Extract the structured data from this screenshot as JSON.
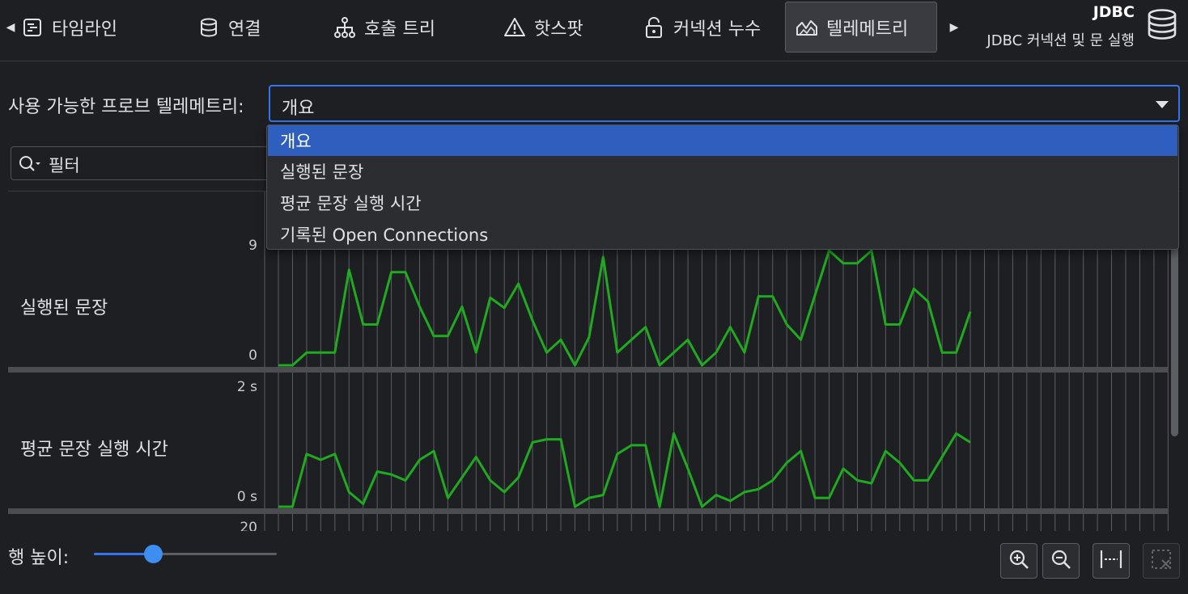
{
  "tabs": [
    {
      "label": "타임라인",
      "icon": "timeline-icon"
    },
    {
      "label": "연결",
      "icon": "database-icon"
    },
    {
      "label": "호출 트리",
      "icon": "call-tree-icon"
    },
    {
      "label": "핫스팟",
      "icon": "warning-icon"
    },
    {
      "label": "커넥션 누수",
      "icon": "lock-icon"
    },
    {
      "label": "텔레메트리",
      "icon": "telemetry-icon",
      "active": true
    }
  ],
  "probe": {
    "title": "JDBC",
    "subtitle": "JDBC 커넥션 및 문 실행"
  },
  "probe_select": {
    "label": "사용 가능한 프로브 텔레메트리:",
    "value": "개요",
    "options": [
      "개요",
      "실행된 문장",
      "평균 문장 실행 시간",
      "기록된 Open Connections"
    ]
  },
  "filter": {
    "placeholder": "필터"
  },
  "rows": [
    {
      "label": "실행된 문장",
      "y_top": "9",
      "y_bottom": "0"
    },
    {
      "label": "평균 문장 실행 시간",
      "y_top": "2 s",
      "y_bottom": "0 s"
    },
    {
      "y_top": "20"
    }
  ],
  "row_height": {
    "label": "행 높이:",
    "value": 0.33
  },
  "toolbar": [
    "zoom-in-icon",
    "zoom-out-icon",
    "fit-width-icon",
    "clear-selection-icon"
  ],
  "colors": {
    "accent": "#3574f0",
    "series": "#1faa1f",
    "selected": "#2e5fbf"
  },
  "chart_data": [
    {
      "type": "line",
      "name": "실행된 문장",
      "ylim": [
        0,
        9
      ],
      "values": [
        0,
        0,
        1,
        1,
        1,
        7.5,
        3.2,
        3.2,
        7.3,
        7.3,
        4.6,
        2.3,
        2.3,
        4.6,
        1,
        5.3,
        4.5,
        6.4,
        3.5,
        1,
        2,
        0,
        2.2,
        8.5,
        1,
        2,
        3,
        0,
        1,
        2,
        0,
        1,
        3,
        1,
        5.4,
        5.4,
        3.2,
        2,
        5.5,
        9,
        8,
        8,
        9,
        3.2,
        3.2,
        6,
        5,
        1,
        1,
        4.2
      ]
    },
    {
      "type": "line",
      "name": "평균 문장 실행 시간",
      "ylim": [
        0,
        2
      ],
      "values": [
        0,
        0,
        0.9,
        0.8,
        0.9,
        0.25,
        0.05,
        0.6,
        0.55,
        0.45,
        0.8,
        0.95,
        0.15,
        0.5,
        0.85,
        0.45,
        0.25,
        0.5,
        1.1,
        1.15,
        1.15,
        0,
        0.15,
        0.2,
        0.9,
        1.05,
        1.05,
        0,
        1.25,
        0.65,
        0,
        0.2,
        0.1,
        0.25,
        0.3,
        0.45,
        0.75,
        0.95,
        0.15,
        0.15,
        0.65,
        0.45,
        0.4,
        0.95,
        0.75,
        0.45,
        0.45,
        0.85,
        1.25,
        1.1
      ]
    }
  ]
}
